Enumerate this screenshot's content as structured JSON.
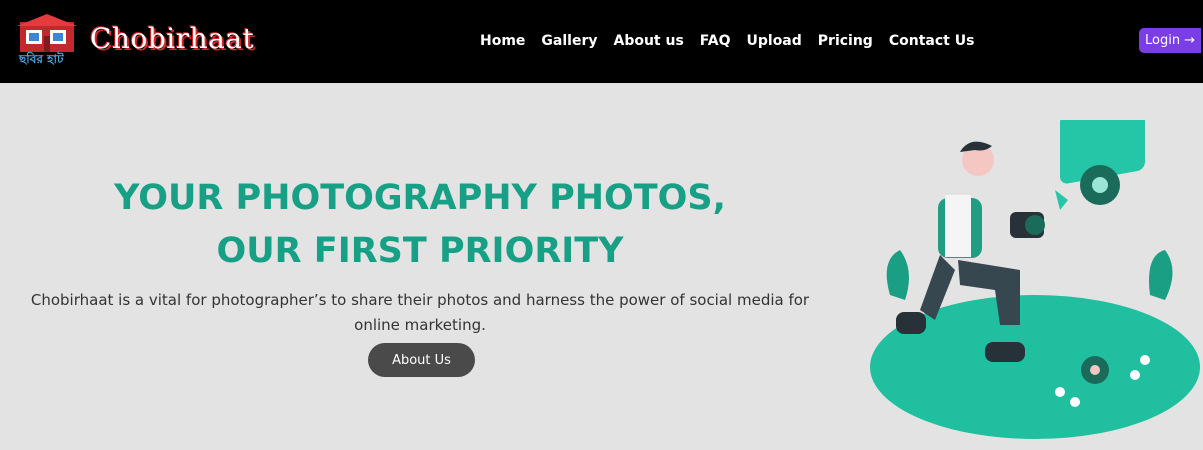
{
  "brand": {
    "name": "Chobirhaat",
    "logo_text": "ছবির হাট"
  },
  "nav": {
    "items": [
      "Home",
      "Gallery",
      "About us",
      "FAQ",
      "Upload",
      "Pricing",
      "Contact Us"
    ],
    "login_label": "Login",
    "login_icon": "arrow-right-icon"
  },
  "hero": {
    "title_line1": "YOUR PHOTOGRAPHY PHOTOS,",
    "title_line2": "OUR FIRST PRIORITY",
    "description": "Chobirhaat is a vital for photographer’s to share their photos and harness the power of social media for online marketing.",
    "cta_label": "About Us"
  },
  "colors": {
    "accent": "#17a086",
    "login_bg": "#7b3de6",
    "navbar_bg": "#000000",
    "page_bg": "#e3e3e3"
  }
}
